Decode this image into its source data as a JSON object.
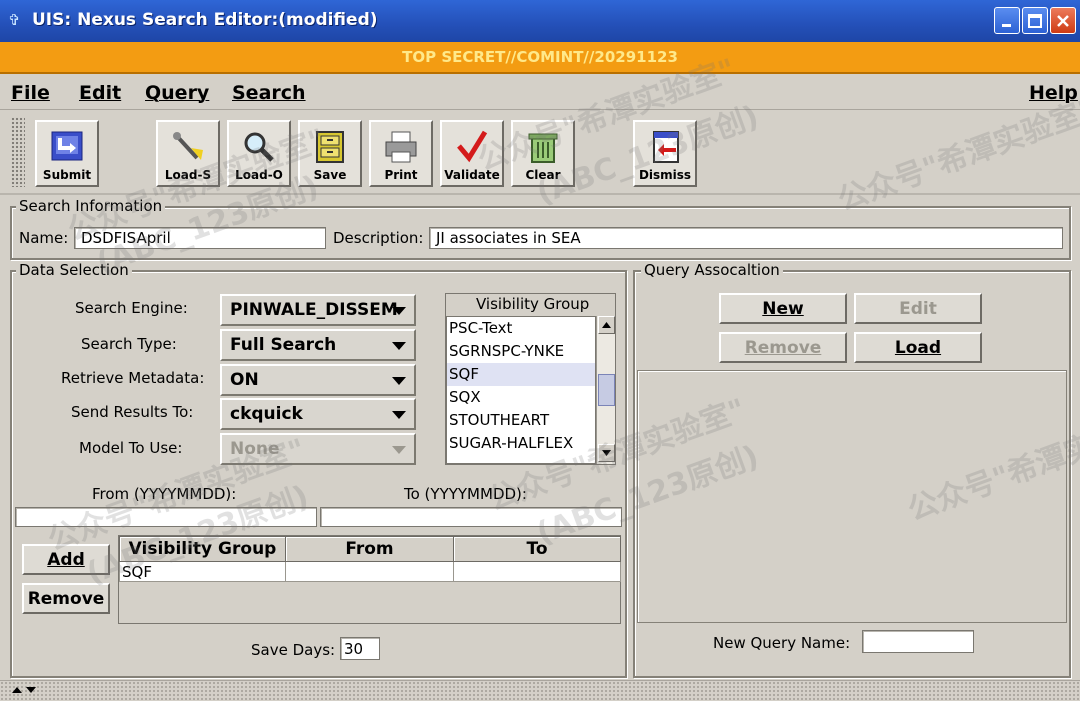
{
  "window": {
    "title": "UIS: Nexus Search Editor:(modified)",
    "classification": "TOP SECRET//COMINT//20291123"
  },
  "menu": {
    "file": "File",
    "edit": "Edit",
    "query": "Query",
    "search": "Search",
    "help": "Help"
  },
  "toolbar": {
    "submit": "Submit",
    "load_s": "Load-S",
    "load_o": "Load-O",
    "save": "Save",
    "print": "Print",
    "validate": "Validate",
    "clear": "Clear",
    "dismiss": "Dismiss"
  },
  "search_info": {
    "title": "Search Information",
    "name_label": "Name:",
    "name_value": "DSDFISApril",
    "description_label": "Description:",
    "description_value": "JI associates in SEA"
  },
  "data_selection": {
    "title": "Data Selection",
    "search_engine_label": "Search Engine:",
    "search_engine_value": "PINWALE_DISSEM",
    "search_type_label": "Search Type:",
    "search_type_value": "Full Search",
    "retrieve_metadata_label": "Retrieve Metadata:",
    "retrieve_metadata_value": "ON",
    "send_results_label": "Send Results To:",
    "send_results_value": "ckquick",
    "model_label": "Model To Use:",
    "model_value": "None",
    "visibility_group_title": "Visibility Group",
    "visibility_list": [
      "PSC-Text",
      "SGRNSPC-YNKE",
      "SQF",
      "SQX",
      "STOUTHEART",
      "SUGAR-HALFLEX"
    ],
    "selected_visibility": "SQF",
    "from_label": "From (YYYYMMDD):",
    "from_value": "",
    "to_label": "To (YYYYMMDD):",
    "to_value": "",
    "add_button": "Add",
    "remove_button": "Remove",
    "table": {
      "headers": [
        "Visibility Group",
        "From",
        "To"
      ],
      "rows": [
        [
          "SQF",
          "",
          ""
        ]
      ]
    },
    "save_days_label": "Save Days:",
    "save_days_value": "30"
  },
  "query_association": {
    "title": "Query Assocaltion",
    "new_button": "New",
    "edit_button": "Edit",
    "remove_button": "Remove",
    "load_button": "Load",
    "new_query_name_label": "New Query Name:",
    "new_query_name_value": ""
  },
  "watermarks": [
    "公众号\"希潭实验室\"",
    "(ABC_123原创)"
  ],
  "colors": {
    "titlebar": "#2450b8",
    "banner": "#f39c12",
    "banner_text": "#ffe98a",
    "panel": "#d4d0c8"
  }
}
